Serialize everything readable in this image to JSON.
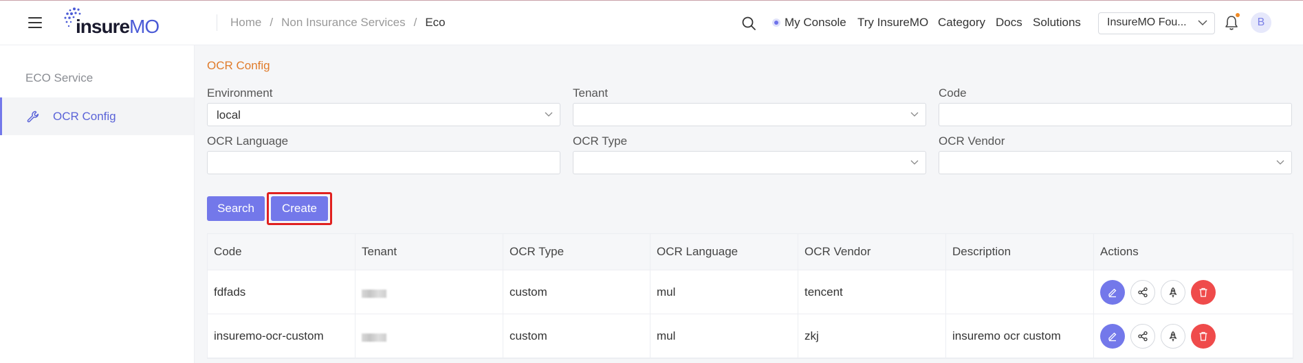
{
  "header": {
    "logo_text_a": "insure",
    "logo_text_b": "MO",
    "breadcrumb": [
      "Home",
      "Non Insurance Services",
      "Eco"
    ],
    "my_console": "My Console",
    "nav": [
      "Try InsureMO",
      "Category",
      "Docs",
      "Solutions"
    ],
    "tenant_select": "InsureMO Fou...",
    "avatar": "B"
  },
  "sidebar": {
    "group": "ECO Service",
    "items": [
      {
        "label": "OCR Config"
      }
    ]
  },
  "page": {
    "title": "OCR Config",
    "filters": {
      "environment_label": "Environment",
      "environment_value": "local",
      "tenant_label": "Tenant",
      "tenant_value": "",
      "code_label": "Code",
      "code_value": "",
      "language_label": "OCR Language",
      "language_value": "",
      "type_label": "OCR Type",
      "type_value": "",
      "vendor_label": "OCR Vendor",
      "vendor_value": ""
    },
    "buttons": {
      "search": "Search",
      "create": "Create"
    },
    "table": {
      "columns": [
        "Code",
        "Tenant",
        "OCR Type",
        "OCR Language",
        "OCR Vendor",
        "Description",
        "Actions"
      ],
      "rows": [
        {
          "code": "fdfads",
          "type": "custom",
          "language": "mul",
          "vendor": "tencent",
          "description": ""
        },
        {
          "code": "insuremo-ocr-custom",
          "type": "custom",
          "language": "mul",
          "vendor": "zkj",
          "description": "insuremo ocr custom"
        }
      ]
    }
  },
  "colors": {
    "accent": "#7378ea",
    "title": "#e07b2a",
    "danger": "#ef4b4b",
    "highlight": "#e0201f"
  }
}
